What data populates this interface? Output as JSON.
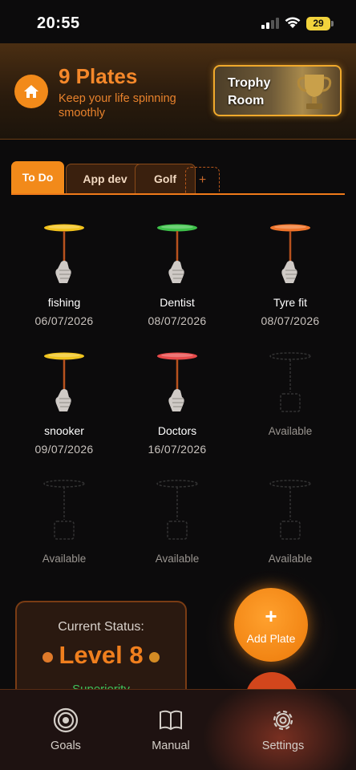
{
  "status_bar": {
    "time": "20:55",
    "battery": "29"
  },
  "header": {
    "title": "9 Plates",
    "subtitle": "Keep your life spinning smoothly",
    "trophy_button": "Trophy Room",
    "home_icon": "home-icon"
  },
  "tabs": [
    {
      "label": "To Do",
      "active": true
    },
    {
      "label": "App dev",
      "active": false
    },
    {
      "label": "Golf",
      "active": false
    },
    {
      "label": "+",
      "active": false
    }
  ],
  "plates": [
    {
      "name": "fishing",
      "date": "06/07/2026",
      "color": "#f2c21c",
      "available": false
    },
    {
      "name": "Dentist",
      "date": "08/07/2026",
      "color": "#3ec24a",
      "available": false
    },
    {
      "name": "Tyre fit",
      "date": "08/07/2026",
      "color": "#f0742a",
      "available": false
    },
    {
      "name": "snooker",
      "date": "09/07/2026",
      "color": "#f0c41e",
      "available": false
    },
    {
      "name": "Doctors",
      "date": "16/07/2026",
      "color": "#e84a4a",
      "available": false
    },
    {
      "name": "Available",
      "date": "",
      "color": "",
      "available": true
    },
    {
      "name": "Available",
      "date": "",
      "color": "",
      "available": true
    },
    {
      "name": "Available",
      "date": "",
      "color": "",
      "available": true
    },
    {
      "name": "Available",
      "date": "",
      "color": "",
      "available": true
    }
  ],
  "status_card": {
    "label": "Current Status:",
    "level": "Level 8",
    "rank": "Superiority"
  },
  "fab": {
    "plus": "+",
    "label": "Add Plate"
  },
  "nav": [
    {
      "label": "Goals",
      "icon": "target-icon"
    },
    {
      "label": "Manual",
      "icon": "book-icon"
    },
    {
      "label": "Settings",
      "icon": "gear-icon"
    }
  ],
  "colors": {
    "accent": "#f28a1a",
    "background": "#0c0b0c"
  }
}
